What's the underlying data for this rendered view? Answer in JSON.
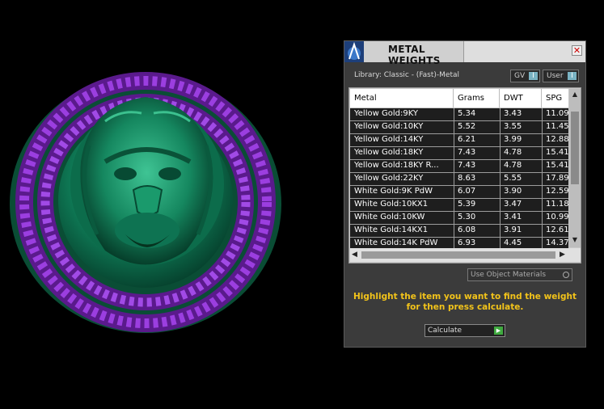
{
  "panel": {
    "title": "METAL WEIGHTS",
    "close_icon": "close-icon",
    "logo_icon": "app-logo-icon",
    "library": "Library: Classic - (Fast)-Metal",
    "gv_label": "GV",
    "user_label": "User",
    "toggle_indicator": "I",
    "columns": [
      "Metal",
      "Grams",
      "DWT",
      "SPG"
    ],
    "rows": [
      [
        "Yellow Gold:9KY",
        "5.34",
        "3.43",
        "11.09"
      ],
      [
        "Yellow Gold:10KY",
        "5.52",
        "3.55",
        "11.45"
      ],
      [
        "Yellow Gold:14KY",
        "6.21",
        "3.99",
        "12.88"
      ],
      [
        "Yellow Gold:18KY",
        "7.43",
        "4.78",
        "15.41"
      ],
      [
        "Yellow Gold:18KY R...",
        "7.43",
        "4.78",
        "15.41"
      ],
      [
        "Yellow Gold:22KY",
        "8.63",
        "5.55",
        "17.89"
      ],
      [
        "White Gold:9K PdW",
        "6.07",
        "3.90",
        "12.59"
      ],
      [
        "White Gold:10KX1",
        "5.39",
        "3.47",
        "11.18"
      ],
      [
        "White Gold:10KW",
        "5.30",
        "3.41",
        "10.99"
      ],
      [
        "White Gold:14KX1",
        "6.08",
        "3.91",
        "12.61"
      ],
      [
        "White Gold:14K PdW",
        "6.93",
        "4.45",
        "14.37"
      ]
    ],
    "use_object_materials": "Use Object Materials",
    "hint": "Highlight the item you want to find the weight for then press calculate.",
    "calculate_label": "Calculate"
  },
  "viewport": {
    "model_colors": {
      "medallion": "#0e7a56",
      "chain": "#7a22b8",
      "background": "#000000"
    }
  }
}
